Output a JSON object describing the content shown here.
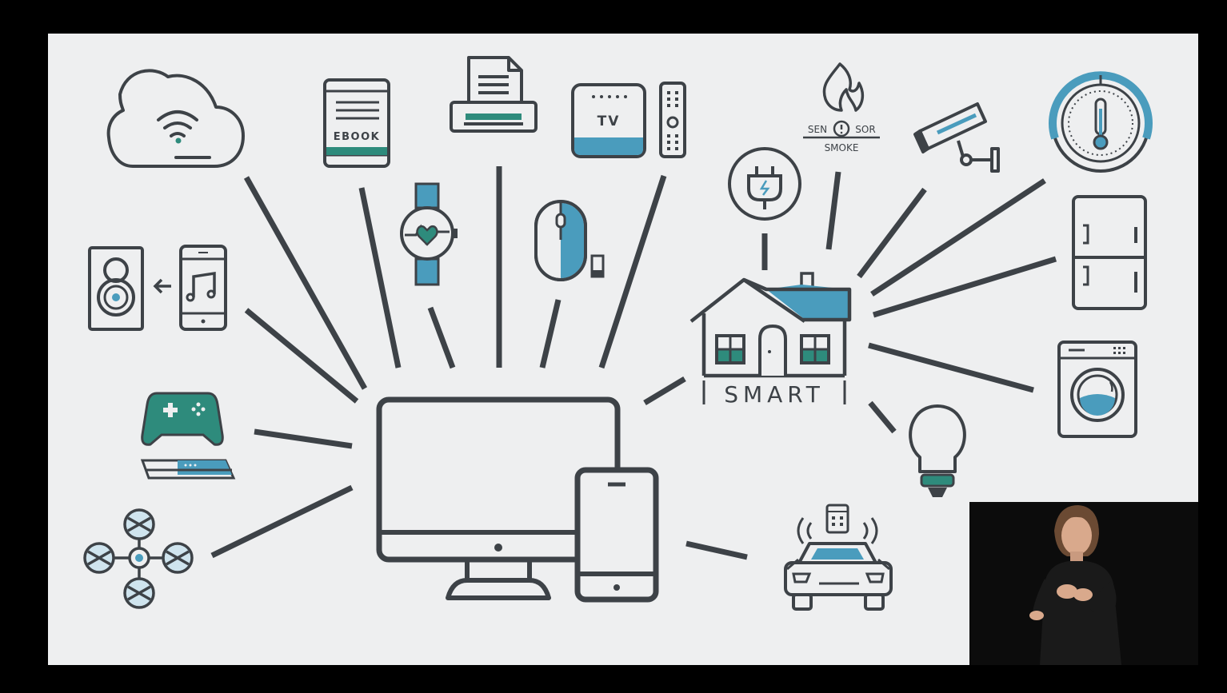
{
  "colors": {
    "background_frame": "#000000",
    "canvas": "#eeeff0",
    "stroke": "#3d4247",
    "accent_blue": "#4a9cbd",
    "accent_teal": "#2e8b7c",
    "pale_blue": "#cfe4ee"
  },
  "labels": {
    "ebook": "EBOOK",
    "tv": "TV",
    "smart": "SMART",
    "sensor_left": "SEN",
    "sensor_right": "SOR",
    "smoke": "SMOKE"
  },
  "devices": [
    "cloud-wifi-icon",
    "ebook-reader-icon",
    "printer-icon",
    "tv-box-icon",
    "remote-control-icon",
    "smoke-sensor-icon",
    "security-camera-icon",
    "thermostat-gauge-icon",
    "speaker-icon",
    "smartphone-music-icon",
    "smartwatch-icon",
    "wireless-mouse-icon",
    "power-plug-icon",
    "smart-house-icon",
    "fridge-icon",
    "game-controller-icon",
    "washing-machine-icon",
    "light-bulb-icon",
    "drone-icon",
    "desktop-monitor-icon",
    "tablet-icon",
    "connected-car-icon"
  ],
  "overlay": {
    "type": "sign-language-interpreter-video"
  }
}
